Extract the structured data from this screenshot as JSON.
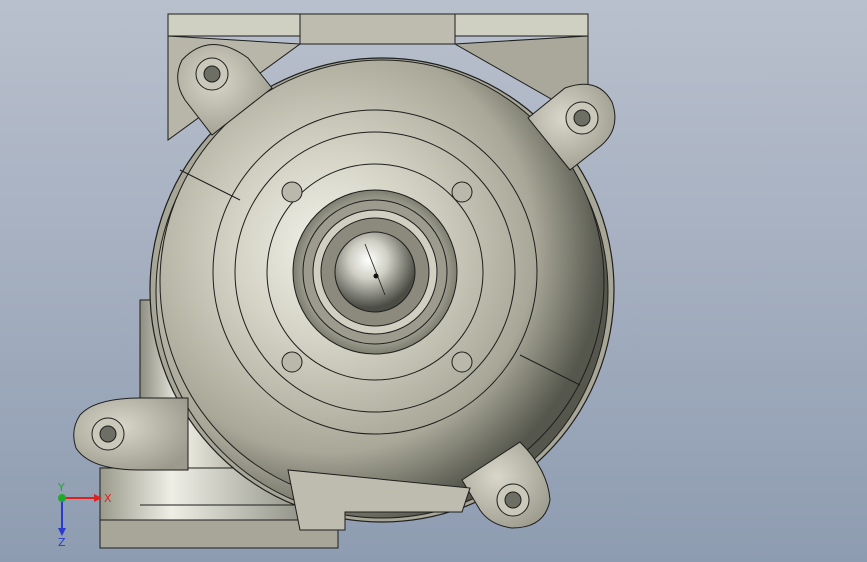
{
  "viewport": {
    "background_top": "#b9c0cd",
    "background_bottom": "#8e9cb1",
    "model_fill": "#c4c3b4",
    "model_shadow": "#5e5f55",
    "model_edge": "#1e1e1c"
  },
  "triad": {
    "x_label": "X",
    "y_label": "Y",
    "z_label": "Z",
    "x_color": "#e0201c",
    "y_color": "#1faa2a",
    "z_color": "#2a3ad0"
  }
}
